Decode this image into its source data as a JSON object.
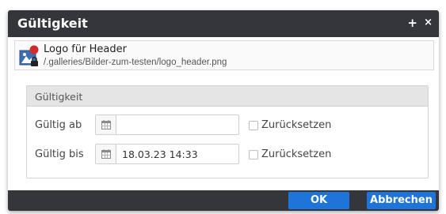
{
  "dialog": {
    "title": "Gültigkeit",
    "plus_label": "+",
    "close_label": "×"
  },
  "file": {
    "title": "Logo für Header",
    "path": "/.galleries/Bilder-zum-testen/logo_header.png",
    "icon": "image-file-icon"
  },
  "validity": {
    "legend": "Gültigkeit",
    "valid_from": {
      "label": "Gültig ab",
      "value": "",
      "reset_label": "Zurücksetzen",
      "reset_checked": false
    },
    "valid_until": {
      "label": "Gültig bis",
      "value": "18.03.23 14:33",
      "reset_label": "Zurücksetzen",
      "reset_checked": false
    }
  },
  "buttons": {
    "ok": "OK",
    "cancel": "Abbrechen"
  },
  "colors": {
    "titlebar": "#34363b",
    "primary_button": "#1e74d8",
    "fieldset_header": "#e5e5e5"
  }
}
